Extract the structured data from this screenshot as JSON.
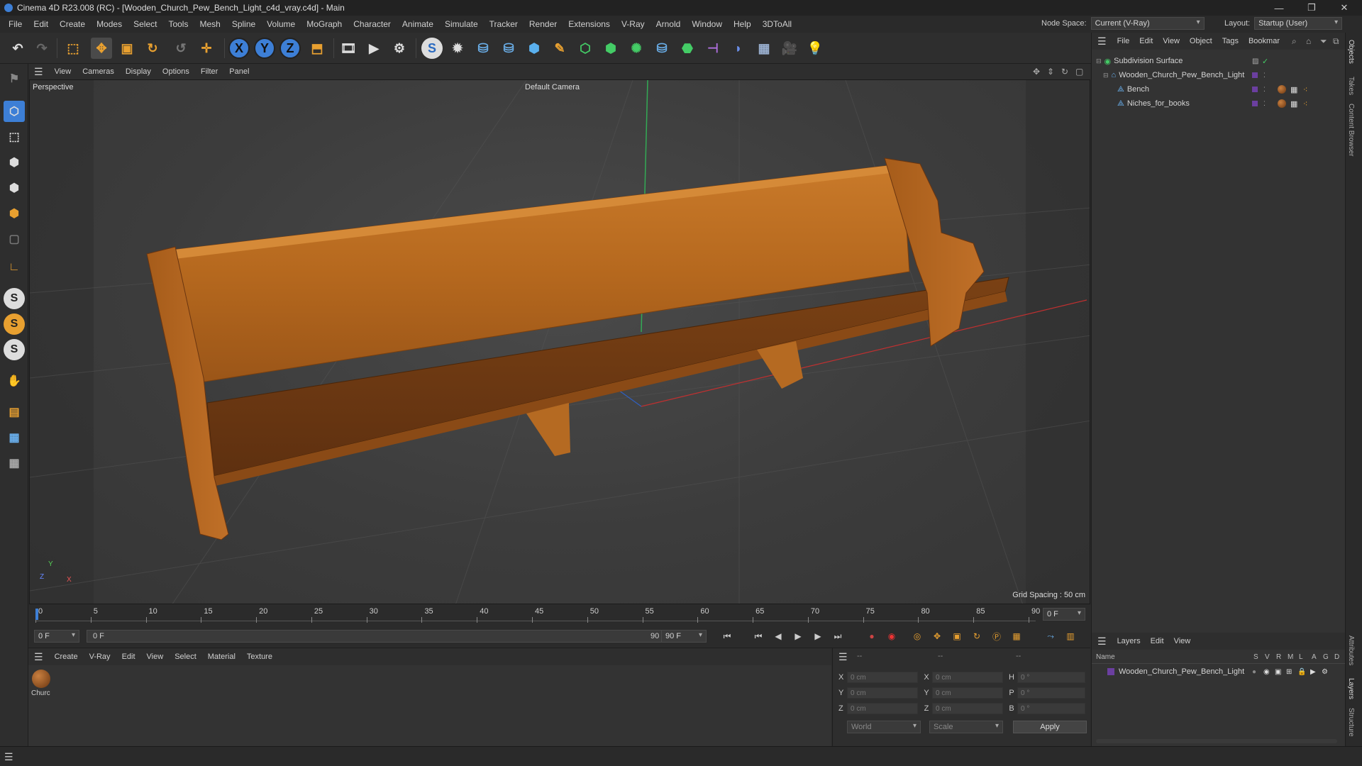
{
  "window": {
    "title": "Cinema 4D R23.008 (RC) - [Wooden_Church_Pew_Bench_Light_c4d_vray.c4d] - Main",
    "minimize": "—",
    "restore": "❐",
    "close": "✕"
  },
  "menu": {
    "items": [
      "File",
      "Edit",
      "Create",
      "Modes",
      "Select",
      "Tools",
      "Mesh",
      "Spline",
      "Volume",
      "MoGraph",
      "Character",
      "Animate",
      "Simulate",
      "Tracker",
      "Render",
      "Extensions",
      "V-Ray",
      "Arnold",
      "Window",
      "Help",
      "3DToAll"
    ],
    "node_space_label": "Node Space:",
    "node_space_value": "Current (V-Ray)",
    "layout_label": "Layout:",
    "layout_value": "Startup (User)"
  },
  "toolbar": {
    "x_axis": "X",
    "y_axis": "Y",
    "z_axis": "Z"
  },
  "viewport": {
    "menu": [
      "View",
      "Cameras",
      "Display",
      "Options",
      "Filter",
      "Panel"
    ],
    "label": "Perspective",
    "camera": "Default Camera",
    "grid_spacing": "Grid Spacing : 50 cm",
    "axis_y": "Y",
    "axis_z": "Z",
    "axis_x": "X"
  },
  "timeline": {
    "ticks": [
      "0",
      "5",
      "10",
      "15",
      "20",
      "25",
      "30",
      "35",
      "40",
      "45",
      "50",
      "55",
      "60",
      "65",
      "70",
      "75",
      "80",
      "85",
      "90"
    ],
    "current_frame_display": "0 F"
  },
  "playback": {
    "start_frame": "0 F",
    "range_start": "0 F",
    "range_end": "90 F",
    "end_frame": "90 F"
  },
  "material_manager": {
    "menu": [
      "Create",
      "V-Ray",
      "Edit",
      "View",
      "Select",
      "Material",
      "Texture"
    ],
    "material_name": "Churc"
  },
  "coordinates": {
    "header_left": "--",
    "header_mid": "--",
    "header_right": "--",
    "x_label": "X",
    "y_label": "Y",
    "z_label": "Z",
    "x_val": "0 cm",
    "y_val": "0 cm",
    "z_val": "0 cm",
    "sx_label": "X",
    "sy_label": "Y",
    "sz_label": "Z",
    "sx_val": "0 cm",
    "sy_val": "0 cm",
    "sz_val": "0 cm",
    "h_label": "H",
    "p_label": "P",
    "b_label": "B",
    "h_val": "0 °",
    "p_val": "0 °",
    "b_val": "0 °",
    "space_select": "World",
    "mode_select": "Scale",
    "apply": "Apply"
  },
  "object_manager": {
    "menu": [
      "File",
      "Edit",
      "View",
      "Object",
      "Tags",
      "Bookmar"
    ],
    "objects": [
      {
        "name": "Subdivision Surface"
      },
      {
        "name": "Wooden_Church_Pew_Bench_Light"
      },
      {
        "name": "Bench"
      },
      {
        "name": "Niches_for_books"
      }
    ]
  },
  "layer_manager": {
    "menu": [
      "Layers",
      "Edit",
      "View"
    ],
    "col_name": "Name",
    "cols": [
      "S",
      "V",
      "R",
      "M",
      "L",
      "A",
      "G",
      "D"
    ],
    "layer_name": "Wooden_Church_Pew_Bench_Light"
  },
  "right_tabs": {
    "objects": "Objects",
    "takes": "Takes",
    "content_browser": "Content Browser",
    "attributes": "Attributes",
    "layers": "Layers",
    "structure": "Structure"
  },
  "colors": {
    "accent_blue": "#3d7fd6",
    "layer_purple": "#6b3fa0",
    "axis_green": "#33aa55",
    "axis_red": "#c03030",
    "wood": "#b8691e"
  }
}
